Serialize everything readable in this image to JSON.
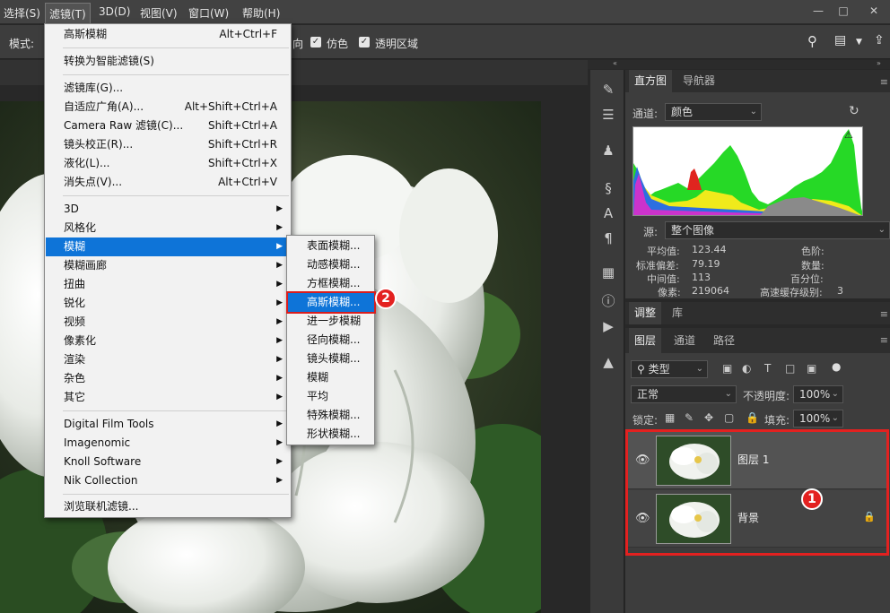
{
  "menubar": {
    "items": [
      "选择(S)",
      "滤镜(T)",
      "3D(D)",
      "视图(V)",
      "窗口(W)",
      "帮助(H)"
    ],
    "active": "滤镜(T)"
  },
  "options_bar": {
    "mode_label": "模式:",
    "partial_label": "向",
    "dither_label": "仿色",
    "transparency_label": "透明区域"
  },
  "filter_menu": {
    "top_items": [
      {
        "label": "高斯模糊",
        "shortcut": "Alt+Ctrl+F"
      }
    ],
    "convert_item": "转换为智能滤镜(S)",
    "gallery_items": [
      {
        "label": "滤镜库(G)...",
        "shortcut": ""
      },
      {
        "label": "自适应广角(A)...",
        "shortcut": "Alt+Shift+Ctrl+A"
      },
      {
        "label": "Camera Raw 滤镜(C)...",
        "shortcut": "Shift+Ctrl+A"
      },
      {
        "label": "镜头校正(R)...",
        "shortcut": "Shift+Ctrl+R"
      },
      {
        "label": "液化(L)...",
        "shortcut": "Shift+Ctrl+X"
      },
      {
        "label": "消失点(V)...",
        "shortcut": "Alt+Ctrl+V"
      }
    ],
    "category_items": [
      "3D",
      "风格化",
      "模糊",
      "模糊画廊",
      "扭曲",
      "锐化",
      "视频",
      "像素化",
      "渲染",
      "杂色",
      "其它"
    ],
    "plugin_items": [
      "Digital Film Tools",
      "Imagenomic",
      "Knoll Software",
      "Nik Collection"
    ],
    "browse_item": "浏览联机滤镜..."
  },
  "blur_submenu": {
    "items": [
      "表面模糊...",
      "动感模糊...",
      "方框模糊...",
      "高斯模糊...",
      "进一步模糊",
      "径向模糊...",
      "镜头模糊...",
      "模糊",
      "平均",
      "特殊模糊...",
      "形状模糊..."
    ],
    "highlighted": "高斯模糊..."
  },
  "histogram_panel": {
    "tabs": [
      "直方图",
      "导航器"
    ],
    "channel_label": "通道:",
    "channel_value": "颜色",
    "source_label": "源:",
    "source_value": "整个图像",
    "stats_left": [
      {
        "label": "平均值:",
        "value": "123.44"
      },
      {
        "label": "标准偏差:",
        "value": "79.19"
      },
      {
        "label": "中间值:",
        "value": "113"
      },
      {
        "label": "像素:",
        "value": "219064"
      }
    ],
    "stats_right": [
      {
        "label": "色阶:",
        "value": ""
      },
      {
        "label": "数量:",
        "value": ""
      },
      {
        "label": "百分位:",
        "value": ""
      },
      {
        "label": "高速缓存级别:",
        "value": "3"
      }
    ]
  },
  "adjust_panel": {
    "tabs": [
      "调整",
      "库"
    ]
  },
  "layers_panel": {
    "tabs": [
      "图层",
      "通道",
      "路径"
    ],
    "filter_kind": "类型",
    "blend_mode": "正常",
    "opacity_label": "不透明度:",
    "opacity_value": "100%",
    "lock_label": "锁定:",
    "fill_label": "填充:",
    "fill_value": "100%",
    "layers": [
      {
        "name": "图层 1",
        "locked": false
      },
      {
        "name": "背景",
        "locked": true
      }
    ]
  },
  "annotations": {
    "marker_1": "1",
    "marker_2": "2",
    "accent_color": "#e32120"
  }
}
